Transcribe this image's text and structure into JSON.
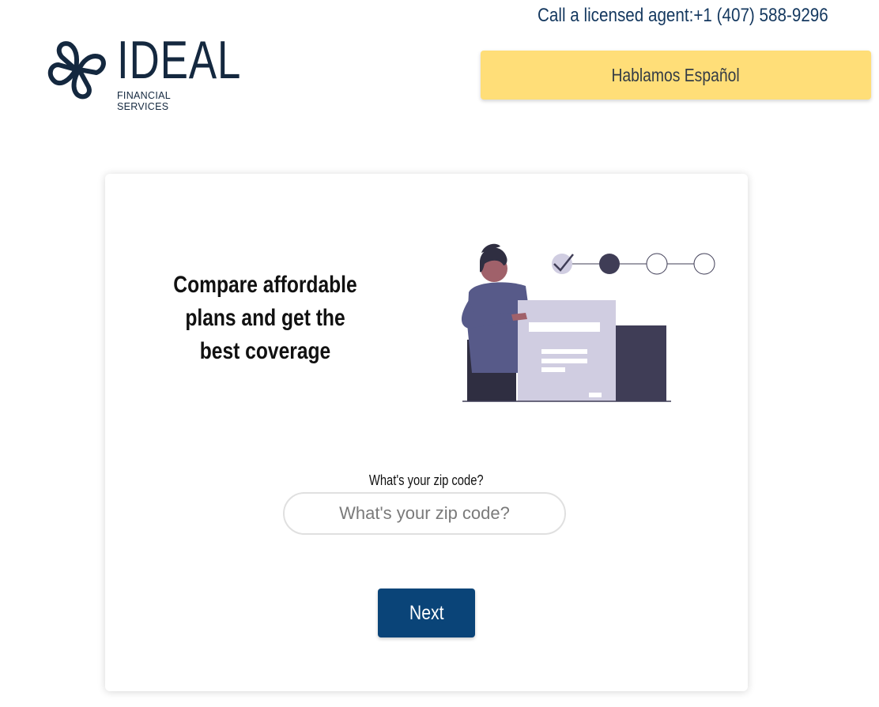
{
  "header": {
    "logo": {
      "word": "IDEAL",
      "subtitle": "FINANCIAL SERVICES",
      "icon": "butterfly-logo-icon"
    },
    "phone_text": "Call a licensed agent:+1 (407) 588-9296",
    "language_button": "Hablamos Español"
  },
  "hero": {
    "headline": "Compare affordable plans and get the best coverage",
    "illustration": "person-with-form-progress-illustration"
  },
  "form": {
    "zip_label": "What's your zip code?",
    "zip_placeholder": "What's your zip code?",
    "zip_value": "",
    "next_label": "Next"
  },
  "colors": {
    "brand_navy": "#14283f",
    "language_button": "#ffde78",
    "next_button": "#0a4478"
  }
}
